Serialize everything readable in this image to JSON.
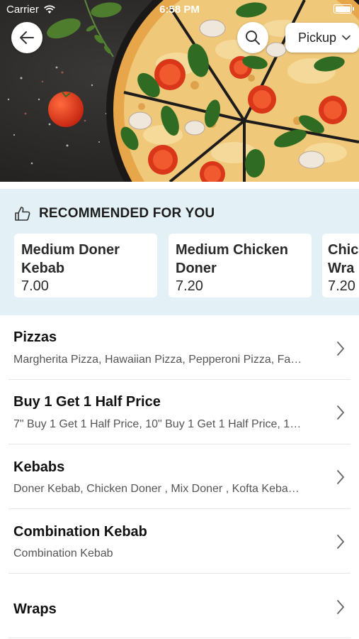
{
  "status_bar": {
    "carrier": "Carrier",
    "time": "6:58 PM"
  },
  "header": {
    "pickup_label": "Pickup"
  },
  "recommended": {
    "title": "RECOMMENDED FOR YOU",
    "items": [
      {
        "name_line1": "Medium Doner",
        "name_line2": "Kebab",
        "price": "7.00"
      },
      {
        "name_line1": "Medium Chicken",
        "name_line2": "Doner",
        "price": "7.20"
      },
      {
        "name_line1": "Chic",
        "name_line2": "Wra",
        "price": "7.20"
      }
    ]
  },
  "categories": [
    {
      "title": "Pizzas",
      "subtitle": "Margherita Pizza, Hawaiian Pizza, Pepperoni Pizza, Fa…"
    },
    {
      "title": "Buy 1 Get 1 Half Price",
      "subtitle": "7\" Buy 1 Get 1 Half Price, 10\" Buy 1 Get 1 Half Price, 1…"
    },
    {
      "title": "Kebabs",
      "subtitle": "Doner Kebab, Chicken Doner , Mix Doner , Kofta Keba…"
    },
    {
      "title": "Combination Kebab",
      "subtitle": "Combination Kebab"
    },
    {
      "title": "Wraps",
      "subtitle": ""
    }
  ],
  "colors": {
    "reco_bg": "#e3f1f7",
    "hero_bg": "#2a2928"
  }
}
